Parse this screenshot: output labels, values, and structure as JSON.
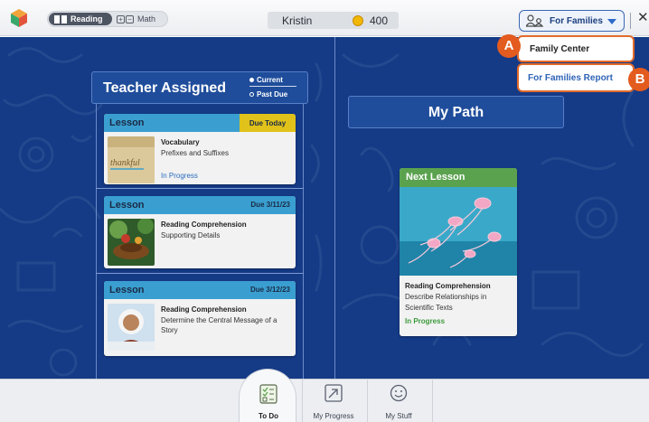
{
  "topbar": {
    "subjects": [
      {
        "label": "Reading",
        "icon": "book-icon",
        "selected": true
      },
      {
        "label": "Math",
        "icon": "plus-minus-icon",
        "selected": false
      }
    ],
    "user_name": "Kristin",
    "coins": "400",
    "families_button": "For Families",
    "close_label": "✕"
  },
  "dropdown": {
    "items": [
      {
        "label": "Family Center",
        "callout": "A"
      },
      {
        "label": "For Families Report",
        "callout": "B"
      }
    ]
  },
  "teacher_assigned": {
    "title": "Teacher Assigned",
    "legend_current": "Current",
    "legend_past_due": "Past Due",
    "cards": [
      {
        "type": "Lesson",
        "due": "Due Today",
        "title": "Vocabulary",
        "subtitle": "Prefixes and Suffixes",
        "status": "In Progress",
        "thumb_text": "thankful"
      },
      {
        "type": "Lesson",
        "due": "Due 3/11/23",
        "title": "Reading Comprehension",
        "subtitle": "Supporting Details",
        "status": ""
      },
      {
        "type": "Lesson",
        "due": "Due 3/12/23",
        "title": "Reading Comprehension",
        "subtitle": "Determine the Central Message of a Story",
        "status": ""
      }
    ]
  },
  "my_path": {
    "title": "My Path",
    "next_lesson": {
      "header": "Next Lesson",
      "title": "Reading Comprehension",
      "subtitle": "Describe Relationships in Scientific Texts",
      "status": "In Progress"
    }
  },
  "bottom_nav": [
    {
      "label": "To Do",
      "icon": "checklist-icon",
      "active": true
    },
    {
      "label": "My Progress",
      "icon": "progress-arrow-icon",
      "active": false
    },
    {
      "label": "My Stuff",
      "icon": "smiley-icon",
      "active": false
    }
  ],
  "colors": {
    "background": "#153a86",
    "panel_header": "#1f4d9b",
    "lesson_header": "#3a9fd0",
    "due_today": "#e0c21a",
    "next_lesson": "#5ba24f",
    "callout": "#e35b1e"
  }
}
